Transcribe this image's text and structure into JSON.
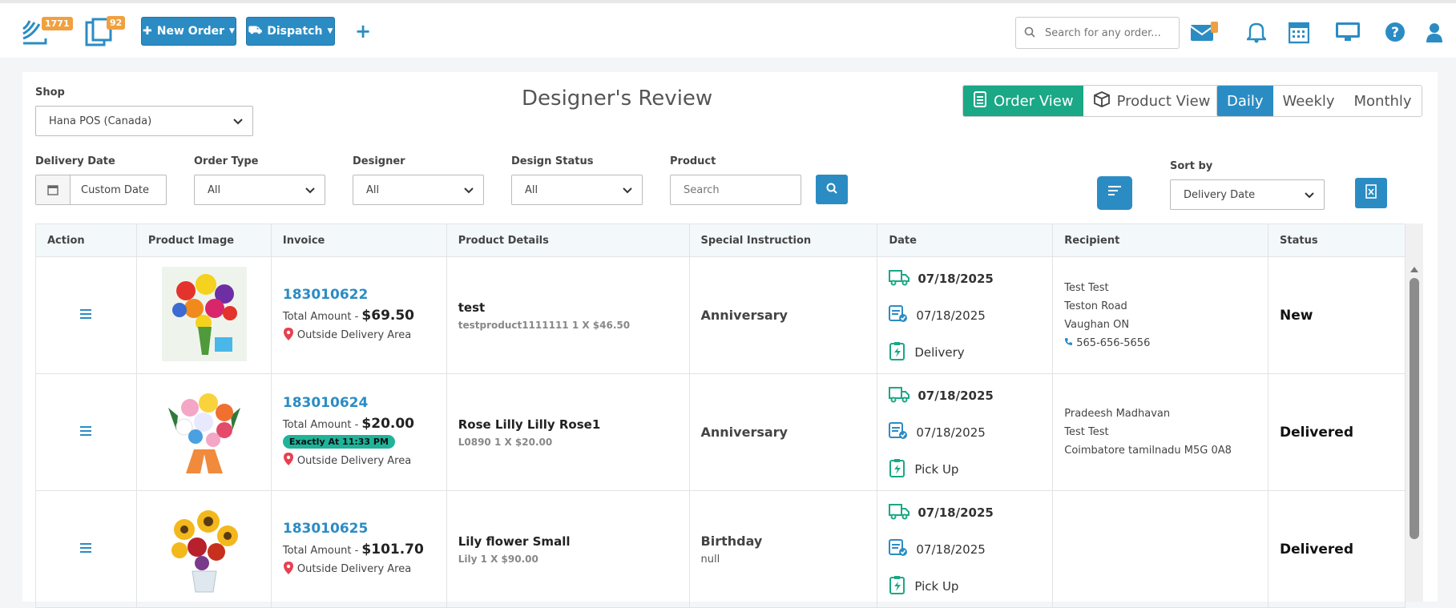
{
  "topbar": {
    "orders_badge": "1771",
    "docs_badge": "92",
    "new_order_label": "New Order",
    "dispatch_label": "Dispatch",
    "search_placeholder": "Search for any order..."
  },
  "filters": {
    "shop_label": "Shop",
    "shop_value": "Hana POS (Canada)",
    "delivery_date_label": "Delivery Date",
    "delivery_date_value": "Custom Date",
    "order_type_label": "Order Type",
    "order_type_value": "All",
    "designer_label": "Designer",
    "designer_value": "All",
    "design_status_label": "Design Status",
    "design_status_value": "All",
    "product_label": "Product",
    "product_placeholder": "Search",
    "sort_label": "Sort by",
    "sort_value": "Delivery Date"
  },
  "page_title": "Designer's Review",
  "view": {
    "order_view": "Order View",
    "product_view": "Product View",
    "daily": "Daily",
    "weekly": "Weekly",
    "monthly": "Monthly"
  },
  "table": {
    "headers": [
      "Action",
      "Product Image",
      "Invoice",
      "Product Details",
      "Special Instruction",
      "Date",
      "Recipient",
      "Status"
    ],
    "rows": [
      {
        "invoice": "183010622",
        "total_label": "Total Amount -",
        "total": "$69.50",
        "timing": "",
        "location": "Outside Delivery Area",
        "product_name": "test",
        "product_sub": "testproduct1111111 1 X $46.50",
        "instruction": "Anniversary",
        "instruction_sub": "",
        "delivery_date": "07/18/2025",
        "order_date": "07/18/2025",
        "method": "Delivery",
        "recipient": [
          "Test Test",
          "Teston Road",
          "Vaughan ON"
        ],
        "phone": "565-656-5656",
        "status": "New"
      },
      {
        "invoice": "183010624",
        "total_label": "Total Amount -",
        "total": "$20.00",
        "timing": "Exactly At 11:33 PM",
        "location": "Outside Delivery Area",
        "product_name": "Rose Lilly Lilly Rose1",
        "product_sub": "L0890 1 X $20.00",
        "instruction": "Anniversary",
        "instruction_sub": "",
        "delivery_date": "07/18/2025",
        "order_date": "07/18/2025",
        "method": "Pick Up",
        "recipient": [
          "Pradeesh Madhavan",
          "Test Test",
          "Coimbatore tamilnadu M5G 0A8"
        ],
        "phone": "",
        "status": "Delivered"
      },
      {
        "invoice": "183010625",
        "total_label": "Total Amount -",
        "total": "$101.70",
        "timing": "",
        "location": "Outside Delivery Area",
        "product_name": "Lily flower Small",
        "product_sub": "Lily 1 X $90.00",
        "instruction": "Birthday",
        "instruction_sub": "null",
        "delivery_date": "07/18/2025",
        "order_date": "07/18/2025",
        "method": "Pick Up",
        "recipient": [],
        "phone": "",
        "status": "Delivered"
      }
    ]
  }
}
